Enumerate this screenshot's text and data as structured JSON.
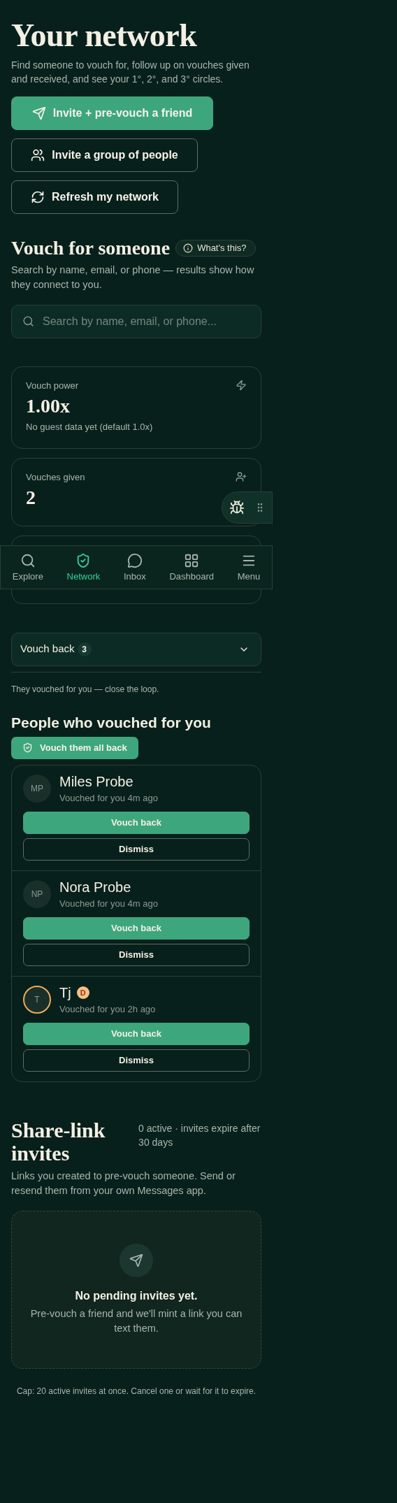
{
  "header": {
    "title": "Your network",
    "subtitle": "Find someone to vouch for, follow up on vouches given and received, and see your 1°, 2°, and 3° circles."
  },
  "actions": [
    {
      "label": "Invite + pre-vouch a friend",
      "kind": "primary"
    },
    {
      "label": "Invite a group of people",
      "kind": "secondary"
    },
    {
      "label": "Refresh my network",
      "kind": "secondary"
    }
  ],
  "vouch_section": {
    "title": "Vouch for someone",
    "help": "What's this?",
    "description": "Search by name, email, or phone — results show how they connect to you.",
    "search": {
      "placeholder": "Search by name, email, or phone..."
    }
  },
  "stats": [
    {
      "label": "Vouch power",
      "value": "1.00x",
      "note": "No guest data yet (default 1.0x)"
    },
    {
      "label": "Vouches given",
      "value": "2"
    }
  ],
  "bottom_nav": [
    {
      "label": "Explore",
      "selected": false
    },
    {
      "label": "Network",
      "selected": true
    },
    {
      "label": "Inbox",
      "selected": false
    },
    {
      "label": "Dashboard",
      "selected": false
    },
    {
      "label": "Menu",
      "selected": false
    }
  ],
  "vouch_back": {
    "label": "Vouch back",
    "count": "3",
    "expanded": false,
    "note": "They vouched for you — close the loop.",
    "title": "People who vouched for you",
    "all_button": "Vouch them all back",
    "people": [
      {
        "initials": "MP",
        "name": "Miles Probe",
        "meta": "Vouched for you 4m ago",
        "ring": false,
        "primary": "Vouch back",
        "secondary": "Dismiss"
      },
      {
        "initials": "NP",
        "name": "Nora Probe",
        "meta": "Vouched for you 4m ago",
        "ring": false,
        "primary": "Vouch back",
        "secondary": "Dismiss"
      },
      {
        "initials": "T",
        "name": "Tj",
        "badge": "D",
        "meta": "Vouched for you 2h ago",
        "ring": true,
        "primary": "Vouch back",
        "secondary": "Dismiss"
      }
    ]
  },
  "share_links": {
    "title": "Share-link invites",
    "status": "0 active · invites expire after 30 days",
    "description": "Links you created to pre-vouch someone. Send or resend them from your own Messages app.",
    "empty": {
      "title": "No pending invites yet.",
      "text": "Pre-vouch a friend and we'll mint a link you can text them."
    },
    "cap": "Cap: 20 active invites at once. Cancel one or wait for it to expire."
  }
}
